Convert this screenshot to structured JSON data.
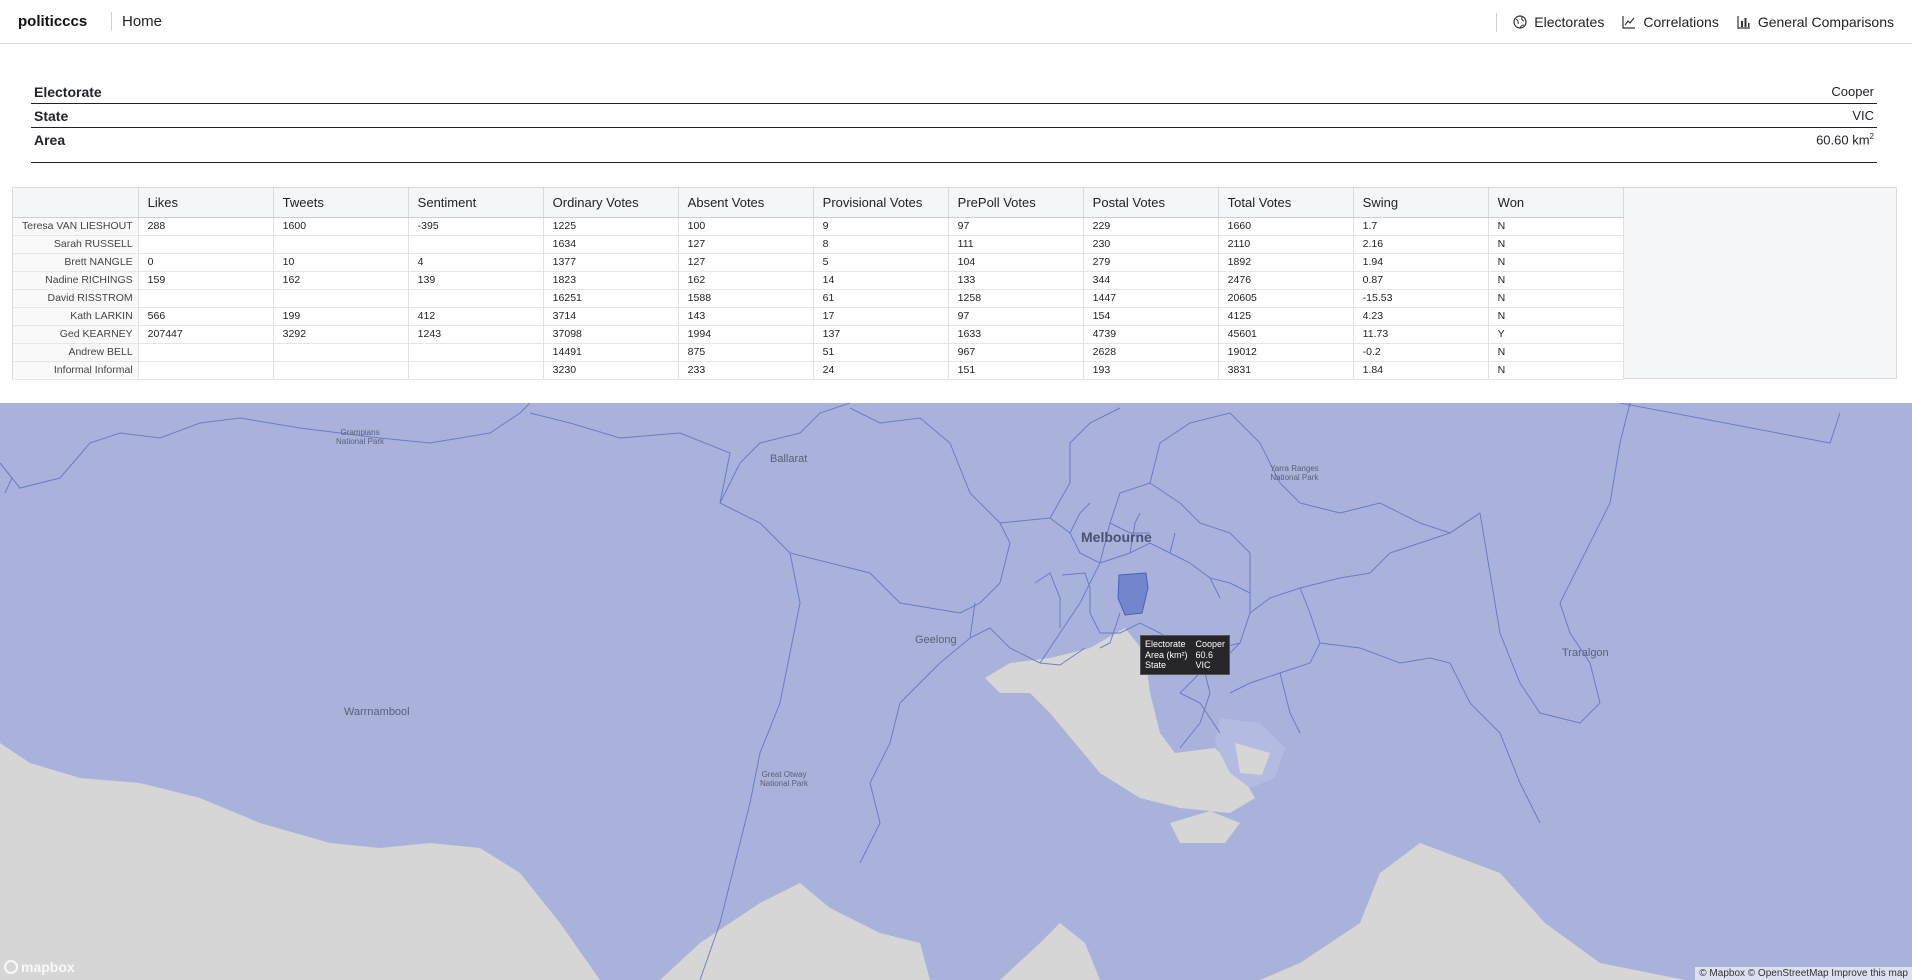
{
  "navbar": {
    "brand": "politicccs",
    "home": "Home",
    "links": [
      {
        "label": "Electorates",
        "icon": "globe-icon"
      },
      {
        "label": "Correlations",
        "icon": "line-chart-icon"
      },
      {
        "label": "General Comparisons",
        "icon": "bar-chart-icon"
      }
    ]
  },
  "info": {
    "electorate_label": "Electorate",
    "electorate_value": "Cooper",
    "state_label": "State",
    "state_value": "VIC",
    "area_label": "Area",
    "area_value": "60.60 km",
    "area_unit_sup": "2"
  },
  "results": {
    "columns": [
      "Likes",
      "Tweets",
      "Sentiment",
      "Ordinary Votes",
      "Absent Votes",
      "Provisional Votes",
      "PrePoll Votes",
      "Postal Votes",
      "Total Votes",
      "Swing",
      "Won"
    ],
    "rows": [
      {
        "name": "Teresa VAN LIESHOUT",
        "cells": [
          "288",
          "1600",
          "-395",
          "1225",
          "100",
          "9",
          "97",
          "229",
          "1660",
          "1.7",
          "N"
        ]
      },
      {
        "name": "Sarah RUSSELL",
        "cells": [
          "",
          "",
          "",
          "1634",
          "127",
          "8",
          "111",
          "230",
          "2110",
          "2.16",
          "N"
        ]
      },
      {
        "name": "Brett NANGLE",
        "cells": [
          "0",
          "10",
          "4",
          "1377",
          "127",
          "5",
          "104",
          "279",
          "1892",
          "1.94",
          "N"
        ]
      },
      {
        "name": "Nadine RICHINGS",
        "cells": [
          "159",
          "162",
          "139",
          "1823",
          "162",
          "14",
          "133",
          "344",
          "2476",
          "0.87",
          "N"
        ]
      },
      {
        "name": "David RISSTROM",
        "cells": [
          "",
          "",
          "",
          "16251",
          "1588",
          "61",
          "1258",
          "1447",
          "20605",
          "-15.53",
          "N"
        ]
      },
      {
        "name": "Kath LARKIN",
        "cells": [
          "566",
          "199",
          "412",
          "3714",
          "143",
          "17",
          "97",
          "154",
          "4125",
          "4.23",
          "N"
        ]
      },
      {
        "name": "Ged KEARNEY",
        "cells": [
          "207447",
          "3292",
          "1243",
          "37098",
          "1994",
          "137",
          "1633",
          "4739",
          "45601",
          "11.73",
          "Y"
        ]
      },
      {
        "name": "Andrew BELL",
        "cells": [
          "",
          "",
          "",
          "14491",
          "875",
          "51",
          "967",
          "2628",
          "19012",
          "-0.2",
          "N"
        ]
      },
      {
        "name": "Informal Informal",
        "cells": [
          "",
          "",
          "",
          "3230",
          "233",
          "24",
          "151",
          "193",
          "3831",
          "1.84",
          "N"
        ]
      }
    ]
  },
  "map": {
    "places": {
      "ballarat": "Ballarat",
      "melbourne": "Melbourne",
      "geelong": "Geelong",
      "warrnambool": "Warrnambool",
      "traralgon": "Traralgon",
      "grampians": "Grampians\nNational Park",
      "yarra": "Yarra Ranges\nNational Park",
      "otway": "Great Otway\nNational Park"
    },
    "tooltip": {
      "labels": [
        "Electorate",
        "Area (km²)",
        "State"
      ],
      "values": [
        "Cooper",
        "60.6",
        "VIC"
      ]
    },
    "colors": {
      "fill": "#a9b2da",
      "border": "#5f72c8",
      "highlight": "#7385cc",
      "water": "#d6d6d6"
    },
    "logo": "mapbox",
    "attribution": "© Mapbox © OpenStreetMap Improve this map"
  }
}
